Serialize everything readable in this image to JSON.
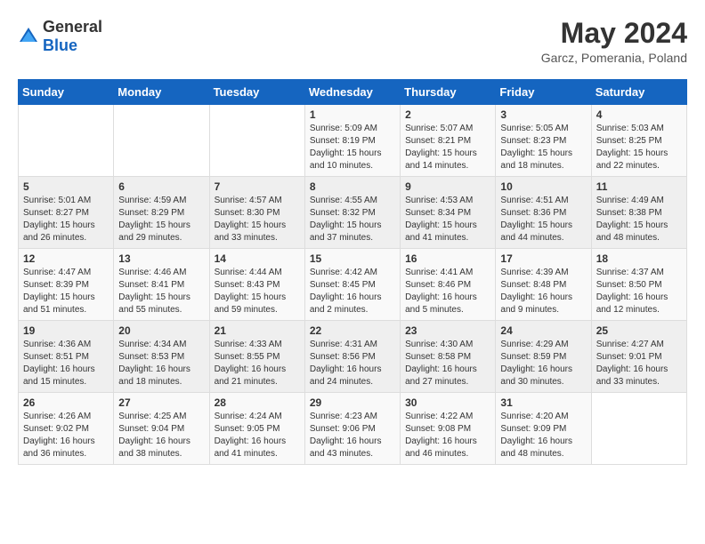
{
  "header": {
    "logo_general": "General",
    "logo_blue": "Blue",
    "title": "May 2024",
    "subtitle": "Garcz, Pomerania, Poland"
  },
  "days_of_week": [
    "Sunday",
    "Monday",
    "Tuesday",
    "Wednesday",
    "Thursday",
    "Friday",
    "Saturday"
  ],
  "weeks": [
    [
      {
        "day": "",
        "info": ""
      },
      {
        "day": "",
        "info": ""
      },
      {
        "day": "",
        "info": ""
      },
      {
        "day": "1",
        "info": "Sunrise: 5:09 AM\nSunset: 8:19 PM\nDaylight: 15 hours\nand 10 minutes."
      },
      {
        "day": "2",
        "info": "Sunrise: 5:07 AM\nSunset: 8:21 PM\nDaylight: 15 hours\nand 14 minutes."
      },
      {
        "day": "3",
        "info": "Sunrise: 5:05 AM\nSunset: 8:23 PM\nDaylight: 15 hours\nand 18 minutes."
      },
      {
        "day": "4",
        "info": "Sunrise: 5:03 AM\nSunset: 8:25 PM\nDaylight: 15 hours\nand 22 minutes."
      }
    ],
    [
      {
        "day": "5",
        "info": "Sunrise: 5:01 AM\nSunset: 8:27 PM\nDaylight: 15 hours\nand 26 minutes."
      },
      {
        "day": "6",
        "info": "Sunrise: 4:59 AM\nSunset: 8:29 PM\nDaylight: 15 hours\nand 29 minutes."
      },
      {
        "day": "7",
        "info": "Sunrise: 4:57 AM\nSunset: 8:30 PM\nDaylight: 15 hours\nand 33 minutes."
      },
      {
        "day": "8",
        "info": "Sunrise: 4:55 AM\nSunset: 8:32 PM\nDaylight: 15 hours\nand 37 minutes."
      },
      {
        "day": "9",
        "info": "Sunrise: 4:53 AM\nSunset: 8:34 PM\nDaylight: 15 hours\nand 41 minutes."
      },
      {
        "day": "10",
        "info": "Sunrise: 4:51 AM\nSunset: 8:36 PM\nDaylight: 15 hours\nand 44 minutes."
      },
      {
        "day": "11",
        "info": "Sunrise: 4:49 AM\nSunset: 8:38 PM\nDaylight: 15 hours\nand 48 minutes."
      }
    ],
    [
      {
        "day": "12",
        "info": "Sunrise: 4:47 AM\nSunset: 8:39 PM\nDaylight: 15 hours\nand 51 minutes."
      },
      {
        "day": "13",
        "info": "Sunrise: 4:46 AM\nSunset: 8:41 PM\nDaylight: 15 hours\nand 55 minutes."
      },
      {
        "day": "14",
        "info": "Sunrise: 4:44 AM\nSunset: 8:43 PM\nDaylight: 15 hours\nand 59 minutes."
      },
      {
        "day": "15",
        "info": "Sunrise: 4:42 AM\nSunset: 8:45 PM\nDaylight: 16 hours\nand 2 minutes."
      },
      {
        "day": "16",
        "info": "Sunrise: 4:41 AM\nSunset: 8:46 PM\nDaylight: 16 hours\nand 5 minutes."
      },
      {
        "day": "17",
        "info": "Sunrise: 4:39 AM\nSunset: 8:48 PM\nDaylight: 16 hours\nand 9 minutes."
      },
      {
        "day": "18",
        "info": "Sunrise: 4:37 AM\nSunset: 8:50 PM\nDaylight: 16 hours\nand 12 minutes."
      }
    ],
    [
      {
        "day": "19",
        "info": "Sunrise: 4:36 AM\nSunset: 8:51 PM\nDaylight: 16 hours\nand 15 minutes."
      },
      {
        "day": "20",
        "info": "Sunrise: 4:34 AM\nSunset: 8:53 PM\nDaylight: 16 hours\nand 18 minutes."
      },
      {
        "day": "21",
        "info": "Sunrise: 4:33 AM\nSunset: 8:55 PM\nDaylight: 16 hours\nand 21 minutes."
      },
      {
        "day": "22",
        "info": "Sunrise: 4:31 AM\nSunset: 8:56 PM\nDaylight: 16 hours\nand 24 minutes."
      },
      {
        "day": "23",
        "info": "Sunrise: 4:30 AM\nSunset: 8:58 PM\nDaylight: 16 hours\nand 27 minutes."
      },
      {
        "day": "24",
        "info": "Sunrise: 4:29 AM\nSunset: 8:59 PM\nDaylight: 16 hours\nand 30 minutes."
      },
      {
        "day": "25",
        "info": "Sunrise: 4:27 AM\nSunset: 9:01 PM\nDaylight: 16 hours\nand 33 minutes."
      }
    ],
    [
      {
        "day": "26",
        "info": "Sunrise: 4:26 AM\nSunset: 9:02 PM\nDaylight: 16 hours\nand 36 minutes."
      },
      {
        "day": "27",
        "info": "Sunrise: 4:25 AM\nSunset: 9:04 PM\nDaylight: 16 hours\nand 38 minutes."
      },
      {
        "day": "28",
        "info": "Sunrise: 4:24 AM\nSunset: 9:05 PM\nDaylight: 16 hours\nand 41 minutes."
      },
      {
        "day": "29",
        "info": "Sunrise: 4:23 AM\nSunset: 9:06 PM\nDaylight: 16 hours\nand 43 minutes."
      },
      {
        "day": "30",
        "info": "Sunrise: 4:22 AM\nSunset: 9:08 PM\nDaylight: 16 hours\nand 46 minutes."
      },
      {
        "day": "31",
        "info": "Sunrise: 4:20 AM\nSunset: 9:09 PM\nDaylight: 16 hours\nand 48 minutes."
      },
      {
        "day": "",
        "info": ""
      }
    ]
  ]
}
